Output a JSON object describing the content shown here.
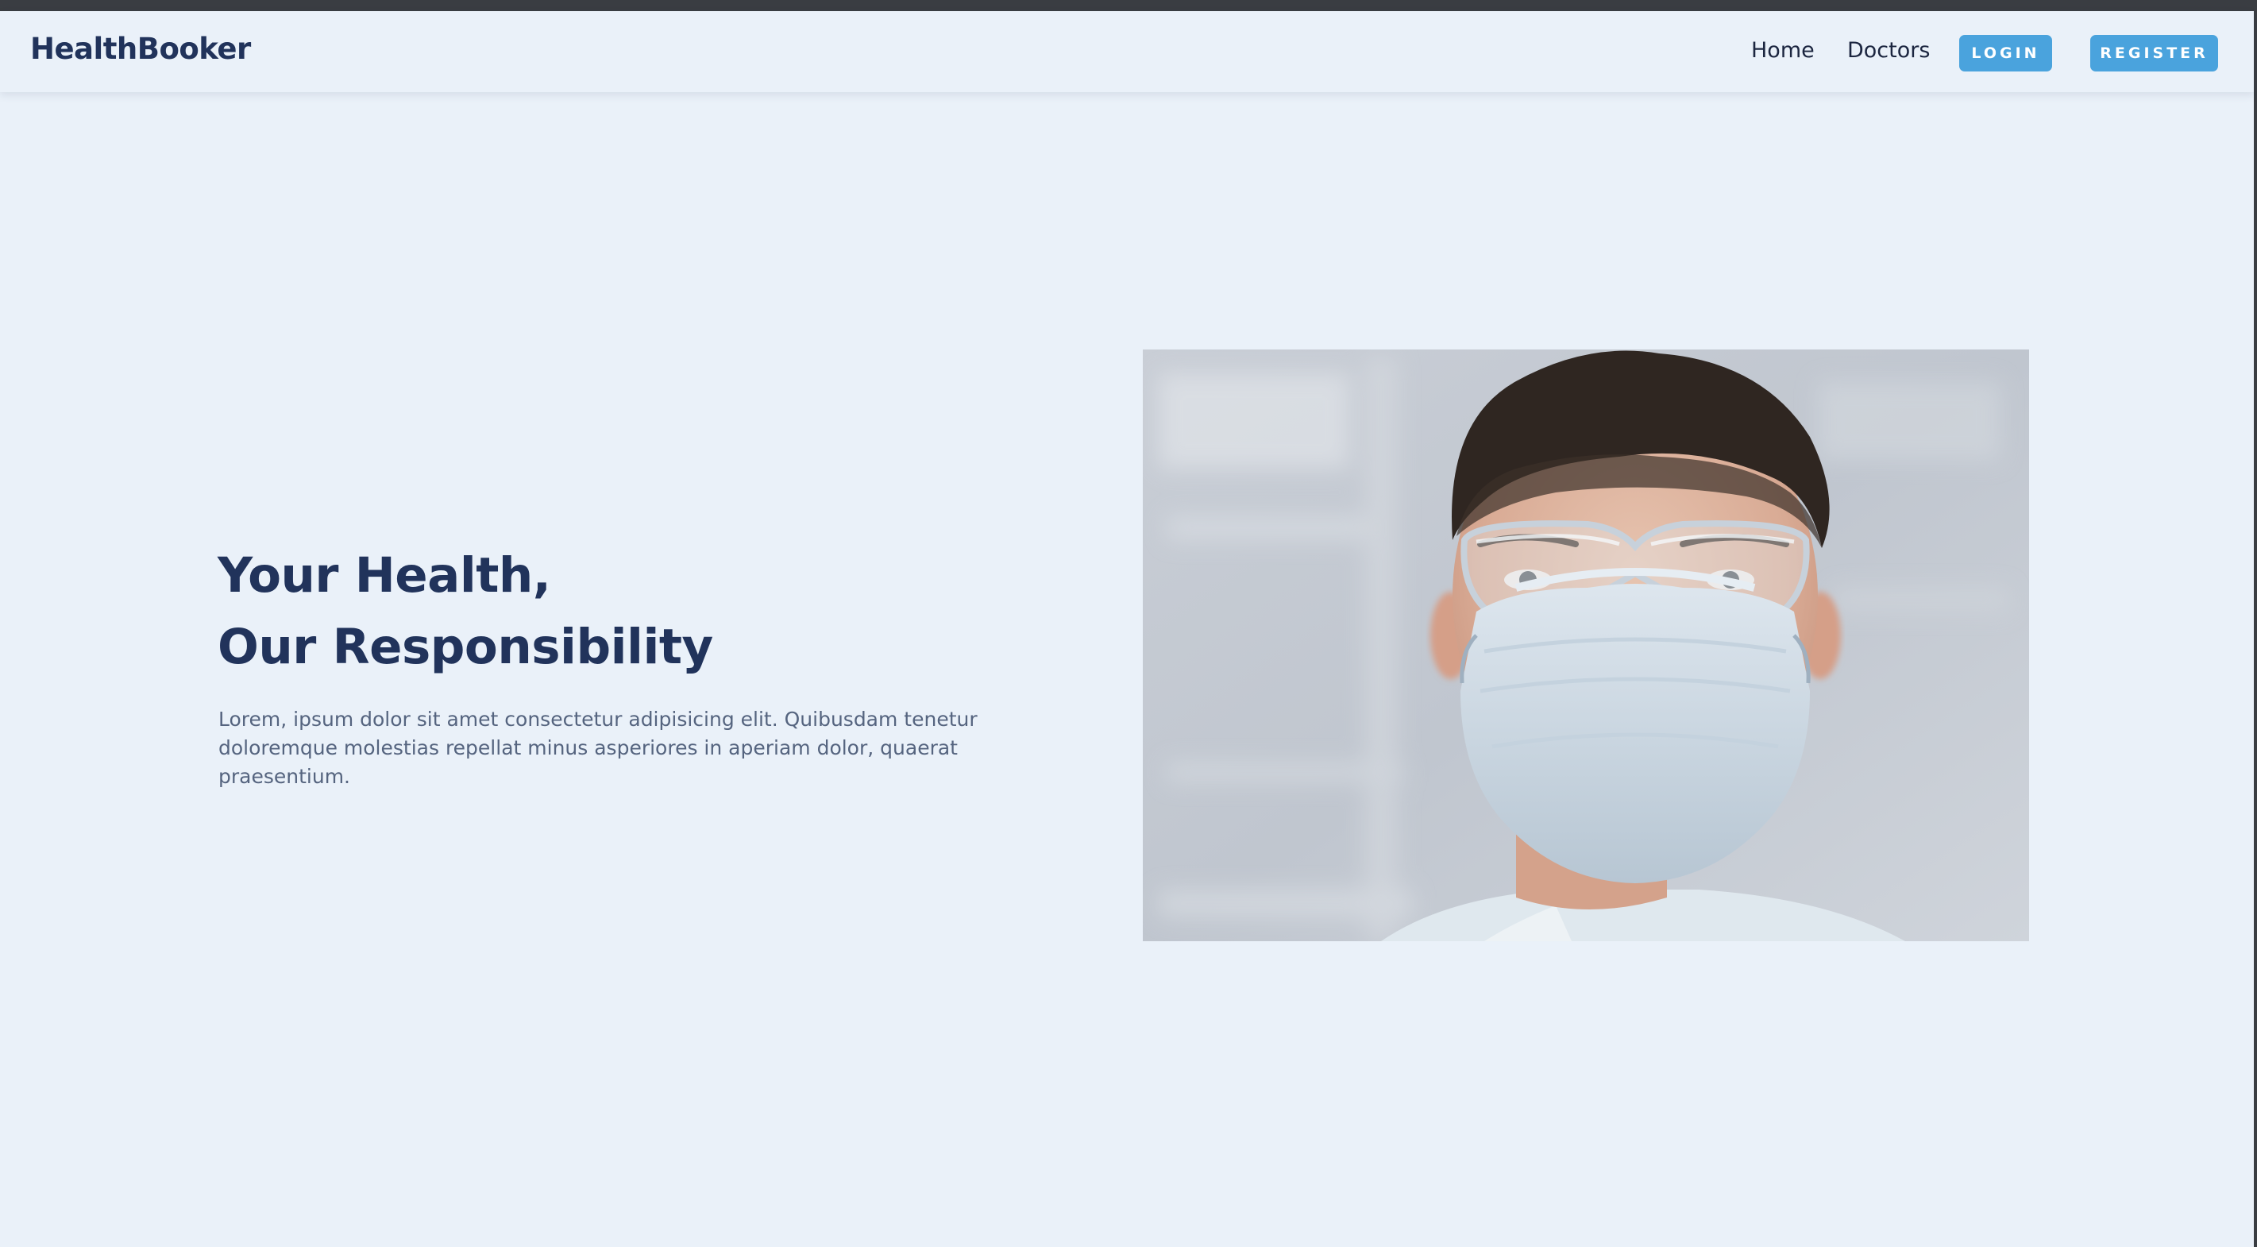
{
  "nav": {
    "brand": "HealthBooker",
    "links": [
      "Home",
      "Doctors"
    ],
    "login_label": "LOGIN",
    "register_label": "REGISTER"
  },
  "hero": {
    "title_line1": "Your Health,",
    "title_line2": "Our Responsibility",
    "description": "Lorem, ipsum dolor sit amet consectetur adipisicing elit. Quibusdam tenetur doloremque molestias repellat minus asperiores in aperiam dolor, quaerat praesentium."
  },
  "colors": {
    "background": "#eaf1f9",
    "brand_text": "#21335b",
    "button": "#4aa3dd",
    "body_text": "#55647f"
  }
}
